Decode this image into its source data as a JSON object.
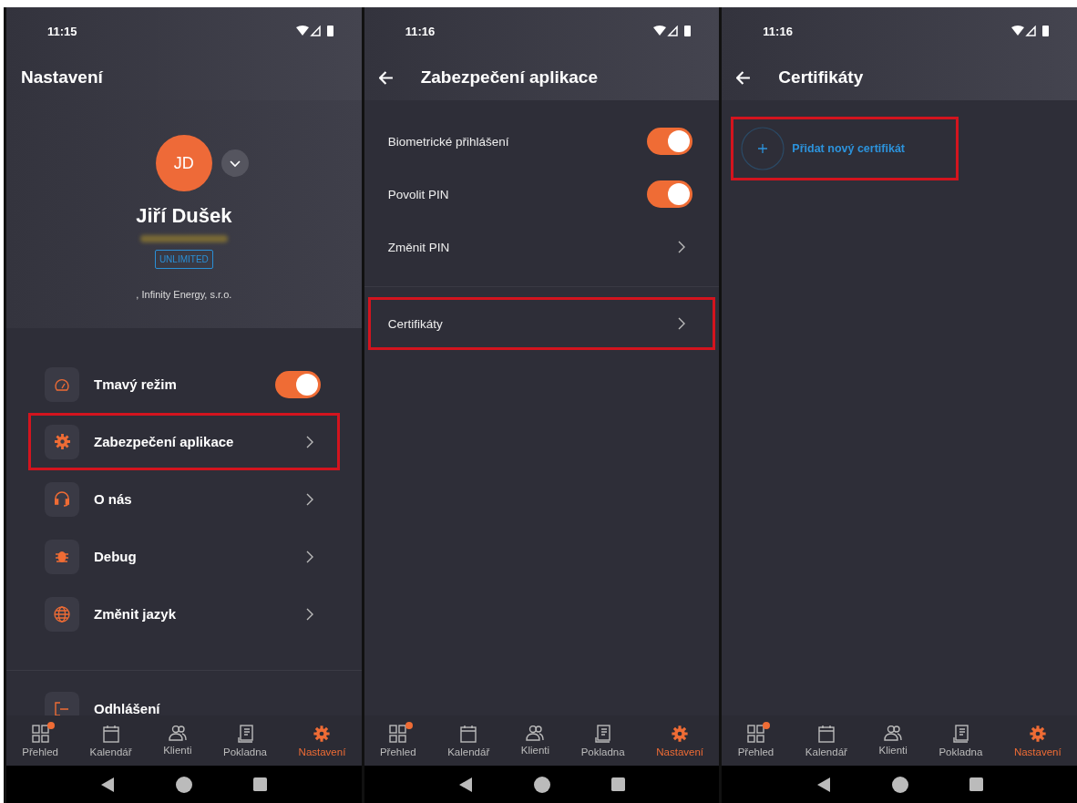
{
  "screens": [
    {
      "kind": "settings",
      "time": "11:15",
      "title": "Nastavení",
      "back": false,
      "profile": {
        "initials": "JD",
        "name": "Jiří Dušek",
        "badge": "UNLIMITED",
        "company": ", Infinity Energy, s.r.o."
      },
      "items": [
        {
          "label": "Tmavý režim",
          "kind": "toggle",
          "on": true,
          "highlighted": false
        },
        {
          "label": "Zabezpečení aplikace",
          "kind": "link",
          "highlighted": true
        },
        {
          "label": "O nás",
          "kind": "link",
          "highlighted": false
        },
        {
          "label": "Debug",
          "kind": "link",
          "highlighted": false
        },
        {
          "label": "Změnit jazyk",
          "kind": "link",
          "highlighted": false
        }
      ],
      "footer_item": {
        "label": "Odhlášení"
      },
      "nav": [
        {
          "label": "Přehled",
          "selected": false,
          "dot": true
        },
        {
          "label": "Kalendář",
          "selected": false,
          "dot": false
        },
        {
          "label": "Klienti",
          "selected": false,
          "dot": false
        },
        {
          "label": "Pokladna",
          "selected": false,
          "dot": false
        },
        {
          "label": "Nastavení",
          "selected": true,
          "dot": false
        }
      ]
    },
    {
      "kind": "security",
      "time": "11:16",
      "title": "Zabezpečení aplikace",
      "back": true,
      "groups": [
        [
          {
            "label": "Biometrické přihlášení",
            "kind": "toggle",
            "on": true,
            "highlighted": false
          },
          {
            "label": "Povolit PIN",
            "kind": "toggle",
            "on": true,
            "highlighted": false
          },
          {
            "label": "Změnit PIN",
            "kind": "link",
            "highlighted": false
          }
        ],
        [
          {
            "label": "Certifikáty",
            "kind": "link",
            "highlighted": true
          }
        ]
      ],
      "nav": [
        {
          "label": "Přehled",
          "selected": false,
          "dot": true
        },
        {
          "label": "Kalendář",
          "selected": false,
          "dot": false
        },
        {
          "label": "Klienti",
          "selected": false,
          "dot": false
        },
        {
          "label": "Pokladna",
          "selected": false,
          "dot": false
        },
        {
          "label": "Nastavení",
          "selected": true,
          "dot": false
        }
      ]
    },
    {
      "kind": "certificates",
      "time": "11:16",
      "title": "Certifikáty",
      "back": true,
      "add_button": {
        "label": "Přidat nový certifikát",
        "highlighted": true
      },
      "nav": [
        {
          "label": "Přehled",
          "selected": false,
          "dot": true
        },
        {
          "label": "Kalendář",
          "selected": false,
          "dot": false
        },
        {
          "label": "Klienti",
          "selected": false,
          "dot": false
        },
        {
          "label": "Pokladna",
          "selected": false,
          "dot": false
        },
        {
          "label": "Nastavení",
          "selected": true,
          "dot": false
        }
      ]
    }
  ]
}
